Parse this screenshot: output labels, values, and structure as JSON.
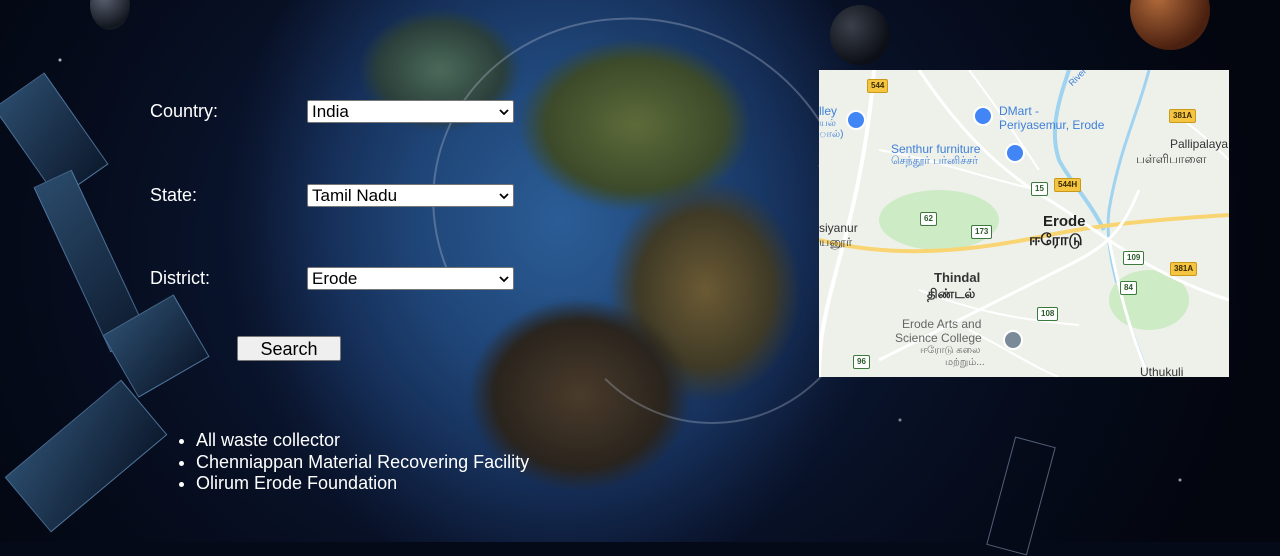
{
  "form": {
    "country_label": "Country:",
    "country_value": "India",
    "state_label": "State:",
    "state_value": "Tamil Nadu",
    "district_label": "District:",
    "district_value": "Erode",
    "search_label": "Search"
  },
  "results": [
    "All waste collector",
    "Chenniappan Material Recovering Facility",
    "Olirum Erode Foundation"
  ],
  "map": {
    "places": {
      "erode_en": "Erode",
      "erode_ta": "ஈரோடு",
      "thindal_en": "Thindal",
      "thindal_ta": "திண்டல்",
      "senthur_en": "Senthur furniture",
      "senthur_ta": "செந்தூர் பர்னிச்சர்",
      "dmart_1": "DMart -",
      "dmart_2": "Periyasemur, Erode",
      "pallipalayam_en": "Pallipalaya",
      "pallipalayam_ta": "பள்ளிபாளை",
      "college_1": "Erode Arts and",
      "college_2": "Science College",
      "college_ta1": "ஈரோடு கலை",
      "college_ta2": "மற்றும்...",
      "siyanur_en": "siyanur",
      "siyanur_ta": "யனூர்",
      "valley_1": "lley",
      "valley_2": "யல்",
      "valley_3": "ால்)",
      "uthukuli": "Uthukuli",
      "river": "River"
    },
    "shields": {
      "s544": "544",
      "s381a_top": "381A",
      "s544h": "544H",
      "s15": "15",
      "s62": "62",
      "s173": "173",
      "s109": "109",
      "s381a_right": "381A",
      "s84": "84",
      "s108": "108",
      "s96": "96"
    },
    "colors": {
      "road": "#ffffff",
      "highway": "#f8d572",
      "water": "#9fd3f0",
      "green": "#cdebc5",
      "pin_blue": "#4285f4",
      "label_blue": "#3f7fd9"
    }
  }
}
